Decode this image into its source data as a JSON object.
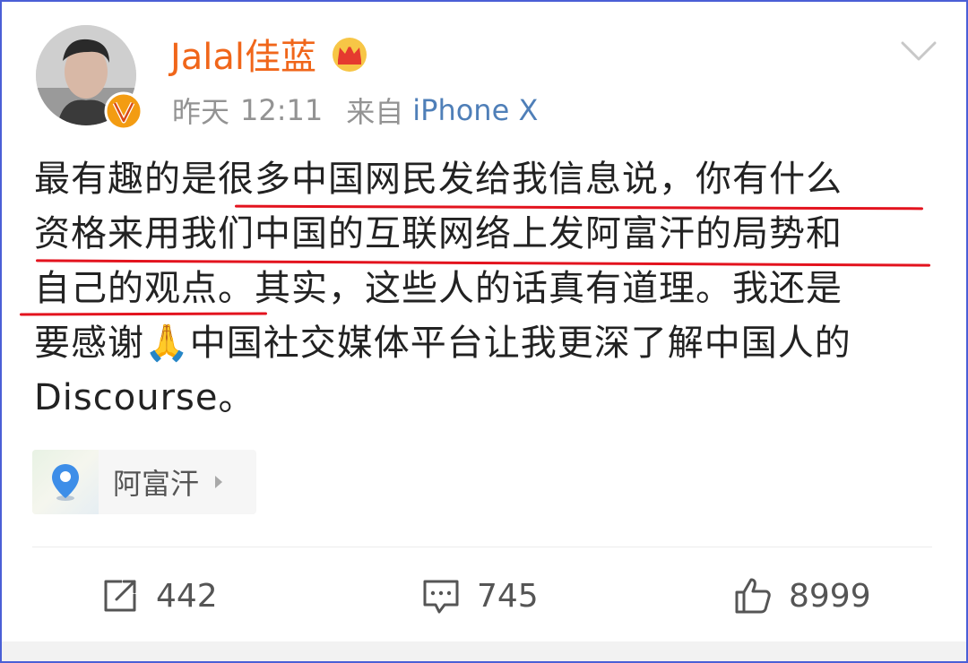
{
  "post": {
    "username": "Jalal佳蓝",
    "date": "昨天",
    "time": "12:11",
    "source_label": "来自",
    "device": "iPhone X",
    "text_lines": [
      "最有趣的是很多中国网民发给我信息说，你有什么",
      "资格来用我们中国的互联网络上发阿富汗的局势和",
      "自己的观点。其实，这些人的话真有道理。我还是",
      "要感谢🙏中国社交媒体平台让我更深了解中国人的",
      "Discourse。"
    ],
    "location": "阿富汗"
  },
  "actions": {
    "share_count": "442",
    "comment_count": "745",
    "like_count": "8999"
  },
  "colors": {
    "username": "#f0661a",
    "device_link": "#4f7fb8",
    "underline": "#e3131e",
    "frame": "#4a5fd6"
  },
  "icons": [
    "verified-v-icon",
    "crown-icon",
    "chevron-down-icon",
    "location-pin-icon",
    "caret-right-icon",
    "share-icon",
    "comment-icon",
    "like-icon"
  ]
}
